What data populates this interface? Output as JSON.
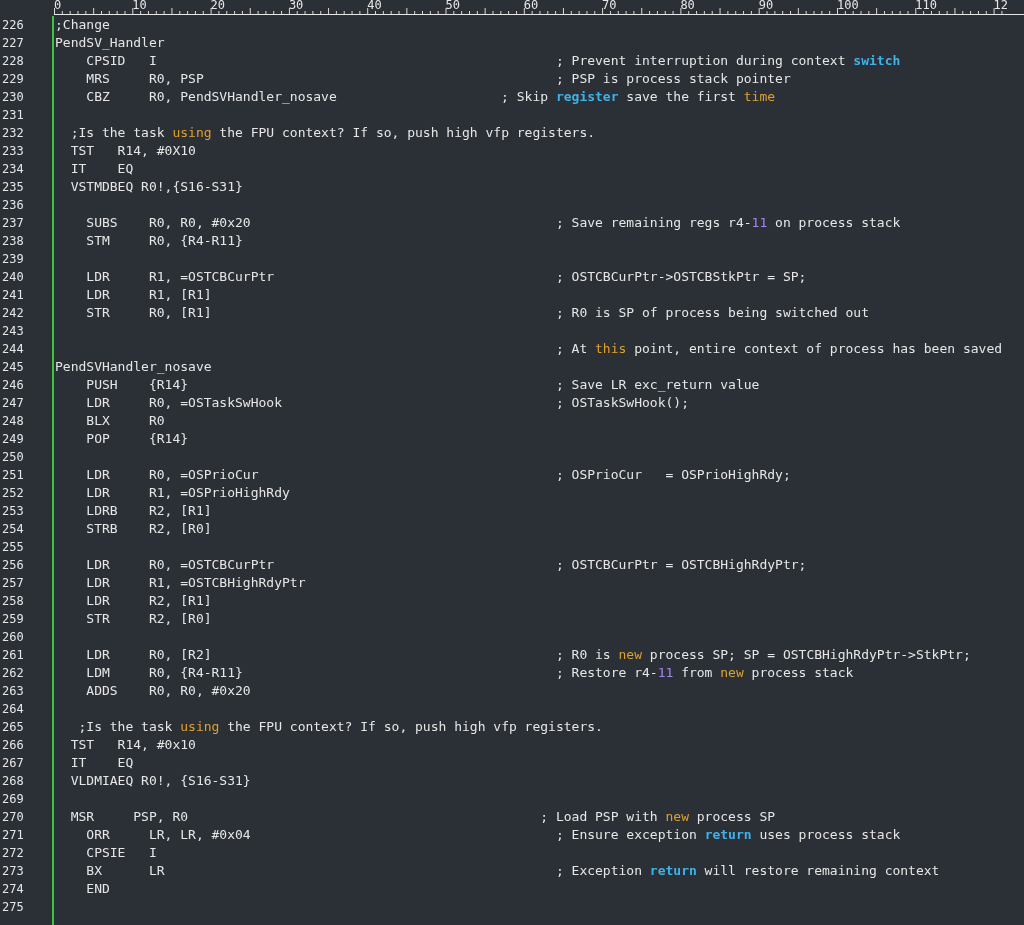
{
  "ruler": [
    "0",
    "10",
    "20",
    "30",
    "40",
    "50",
    "60",
    "70",
    "80",
    "90",
    "100",
    "110",
    "12"
  ],
  "lines": [
    {
      "number": "226",
      "segments": [
        {
          "kind": "text",
          "text": ";Change"
        }
      ]
    },
    {
      "number": "227",
      "segments": [
        {
          "kind": "text",
          "text": "PendSV_Handler"
        }
      ]
    },
    {
      "number": "228",
      "segments": [
        {
          "kind": "text",
          "text": "    CPSID   I                                                   ; Prevent interruption during context "
        },
        {
          "kind": "builtin",
          "text": "switch"
        }
      ]
    },
    {
      "number": "229",
      "segments": [
        {
          "kind": "text",
          "text": "    MRS     R0, PSP                                             ; PSP is process stack pointer"
        }
      ]
    },
    {
      "number": "230",
      "segments": [
        {
          "kind": "text",
          "text": "    CBZ     R0, PendSVHandler_nosave                     ; Skip "
        },
        {
          "kind": "builtin",
          "text": "register"
        },
        {
          "kind": "text",
          "text": " save the first "
        },
        {
          "kind": "keyword",
          "text": "time"
        }
      ]
    },
    {
      "number": "231"
    },
    {
      "number": "232",
      "segments": [
        {
          "kind": "text",
          "text": "  ;Is the task "
        },
        {
          "kind": "keyword",
          "text": "using"
        },
        {
          "kind": "text",
          "text": " the FPU context? If so, push high vfp registers."
        }
      ]
    },
    {
      "number": "233",
      "segments": [
        {
          "kind": "text",
          "text": "  TST   R14, #0X10"
        }
      ]
    },
    {
      "number": "234",
      "segments": [
        {
          "kind": "text",
          "text": "  IT    EQ"
        }
      ]
    },
    {
      "number": "235",
      "segments": [
        {
          "kind": "text",
          "text": "  VSTMDBEQ R0!,{S16-S31}"
        }
      ]
    },
    {
      "number": "236"
    },
    {
      "number": "237",
      "segments": [
        {
          "kind": "text",
          "text": "    SUBS    R0, R0, #0x20                                       ; Save remaining regs r4-"
        },
        {
          "kind": "number",
          "text": "11"
        },
        {
          "kind": "text",
          "text": " on process stack"
        }
      ]
    },
    {
      "number": "238",
      "segments": [
        {
          "kind": "text",
          "text": "    STM     R0, {R4-R11}"
        }
      ]
    },
    {
      "number": "239"
    },
    {
      "number": "240",
      "segments": [
        {
          "kind": "text",
          "text": "    LDR     R1, =OSTCBCurPtr                                    ; OSTCBCurPtr->OSTCBStkPtr = SP;"
        }
      ]
    },
    {
      "number": "241",
      "segments": [
        {
          "kind": "text",
          "text": "    LDR     R1, [R1]"
        }
      ]
    },
    {
      "number": "242",
      "segments": [
        {
          "kind": "text",
          "text": "    STR     R0, [R1]                                            ; R0 is SP of process being switched out"
        }
      ]
    },
    {
      "number": "243"
    },
    {
      "number": "244",
      "segments": [
        {
          "kind": "text",
          "text": "                                                                ; At "
        },
        {
          "kind": "keyword",
          "text": "this"
        },
        {
          "kind": "text",
          "text": " point, entire context of process has been saved"
        }
      ]
    },
    {
      "number": "245",
      "segments": [
        {
          "kind": "text",
          "text": "PendSVHandler_nosave"
        }
      ]
    },
    {
      "number": "246",
      "segments": [
        {
          "kind": "text",
          "text": "    PUSH    {R14}                                               ; Save LR exc_return value"
        }
      ]
    },
    {
      "number": "247",
      "segments": [
        {
          "kind": "text",
          "text": "    LDR     R0, =OSTaskSwHook                                   ; OSTaskSwHook();"
        }
      ]
    },
    {
      "number": "248",
      "segments": [
        {
          "kind": "text",
          "text": "    BLX     R0"
        }
      ]
    },
    {
      "number": "249",
      "segments": [
        {
          "kind": "text",
          "text": "    POP     {R14}"
        }
      ]
    },
    {
      "number": "250"
    },
    {
      "number": "251",
      "segments": [
        {
          "kind": "text",
          "text": "    LDR     R0, =OSPrioCur                                      ; OSPrioCur   = OSPrioHighRdy;"
        }
      ]
    },
    {
      "number": "252",
      "segments": [
        {
          "kind": "text",
          "text": "    LDR     R1, =OSPrioHighRdy"
        }
      ]
    },
    {
      "number": "253",
      "segments": [
        {
          "kind": "text",
          "text": "    LDRB    R2, [R1]"
        }
      ]
    },
    {
      "number": "254",
      "segments": [
        {
          "kind": "text",
          "text": "    STRB    R2, [R0]"
        }
      ]
    },
    {
      "number": "255"
    },
    {
      "number": "256",
      "segments": [
        {
          "kind": "text",
          "text": "    LDR     R0, =OSTCBCurPtr                                    ; OSTCBCurPtr = OSTCBHighRdyPtr;"
        }
      ]
    },
    {
      "number": "257",
      "segments": [
        {
          "kind": "text",
          "text": "    LDR     R1, =OSTCBHighRdyPtr"
        }
      ]
    },
    {
      "number": "258",
      "segments": [
        {
          "kind": "text",
          "text": "    LDR     R2, [R1]"
        }
      ]
    },
    {
      "number": "259",
      "segments": [
        {
          "kind": "text",
          "text": "    STR     R2, [R0]"
        }
      ]
    },
    {
      "number": "260"
    },
    {
      "number": "261",
      "segments": [
        {
          "kind": "text",
          "text": "    LDR     R0, [R2]                                            ; R0 is "
        },
        {
          "kind": "keyword",
          "text": "new"
        },
        {
          "kind": "text",
          "text": " process SP; SP = OSTCBHighRdyPtr->StkPtr;"
        }
      ]
    },
    {
      "number": "262",
      "segments": [
        {
          "kind": "text",
          "text": "    LDM     R0, {R4-R11}                                        ; Restore r4-"
        },
        {
          "kind": "number",
          "text": "11"
        },
        {
          "kind": "text",
          "text": " from "
        },
        {
          "kind": "keyword",
          "text": "new"
        },
        {
          "kind": "text",
          "text": " process stack"
        }
      ]
    },
    {
      "number": "263",
      "segments": [
        {
          "kind": "text",
          "text": "    ADDS    R0, R0, #0x20"
        }
      ]
    },
    {
      "number": "264"
    },
    {
      "number": "265",
      "segments": [
        {
          "kind": "text",
          "text": "   ;Is the task "
        },
        {
          "kind": "keyword",
          "text": "using"
        },
        {
          "kind": "text",
          "text": " the FPU context? If so, push high vfp registers."
        }
      ]
    },
    {
      "number": "266",
      "segments": [
        {
          "kind": "text",
          "text": "  TST   R14, #0x10"
        }
      ]
    },
    {
      "number": "267",
      "segments": [
        {
          "kind": "text",
          "text": "  IT    EQ"
        }
      ]
    },
    {
      "number": "268",
      "segments": [
        {
          "kind": "text",
          "text": "  VLDMIAEQ R0!, {S16-S31}"
        }
      ]
    },
    {
      "number": "269"
    },
    {
      "number": "270",
      "segments": [
        {
          "kind": "text",
          "text": "  MSR     PSP, R0                                             ; Load PSP with "
        },
        {
          "kind": "keyword",
          "text": "new"
        },
        {
          "kind": "text",
          "text": " process SP"
        }
      ]
    },
    {
      "number": "271",
      "segments": [
        {
          "kind": "text",
          "text": "    ORR     LR, LR, #0x04                                       ; Ensure exception "
        },
        {
          "kind": "builtin",
          "text": "return"
        },
        {
          "kind": "text",
          "text": " uses process stack"
        }
      ]
    },
    {
      "number": "272",
      "segments": [
        {
          "kind": "text",
          "text": "    CPSIE   I"
        }
      ]
    },
    {
      "number": "273",
      "segments": [
        {
          "kind": "text",
          "text": "    BX      LR                                                  ; Exception "
        },
        {
          "kind": "builtin",
          "text": "return"
        },
        {
          "kind": "text",
          "text": " will restore remaining context"
        }
      ]
    },
    {
      "number": "274",
      "segments": [
        {
          "kind": "text",
          "text": "    END"
        }
      ]
    },
    {
      "number": "275"
    }
  ]
}
